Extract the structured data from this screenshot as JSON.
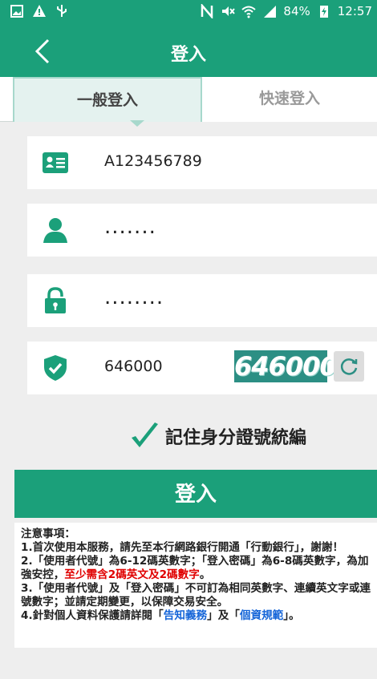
{
  "status_bar": {
    "battery": "84%",
    "time": "12:57"
  },
  "header": {
    "title": "登入"
  },
  "tabs": [
    {
      "label": "一般登入",
      "active": true
    },
    {
      "label": "快速登入",
      "active": false
    }
  ],
  "form": {
    "id_number": "A123456789",
    "user_code_masked": ".......",
    "password_masked": "........",
    "captcha_input": "646000",
    "captcha_image_text": "646000"
  },
  "remember": {
    "label": "記住身分證號統編"
  },
  "login_button": {
    "label": "登入"
  },
  "notes": {
    "title": "注意事項：",
    "item1": "1.首次使用本服務，請先至本行網路銀行開通「行動銀行」，謝謝！",
    "item2_a": "2.「使用者代號」為6-12碼英數字；「登入密碼」為6-8碼英數字，為加強安控，",
    "item2_b": "至少需含2碼英文及2碼數字",
    "item2_c": "。",
    "item3": "3.「使用者代號」及「登入密碼」不可訂為相同英數字、連續英文字或連號數字；並請定期變更，以保障交易安全。",
    "item4_a": "4.針對個人資料保護請詳閱「",
    "item4_link1": "告知義務",
    "item4_b": "」及「",
    "item4_link2": "個資規範",
    "item4_c": "」。"
  },
  "colors": {
    "brand": "#1ba07a",
    "tab_active_bg": "#e4f2ef",
    "captcha_bg": "#2c8f84",
    "warning": "#e00000",
    "link": "#1565d8"
  }
}
